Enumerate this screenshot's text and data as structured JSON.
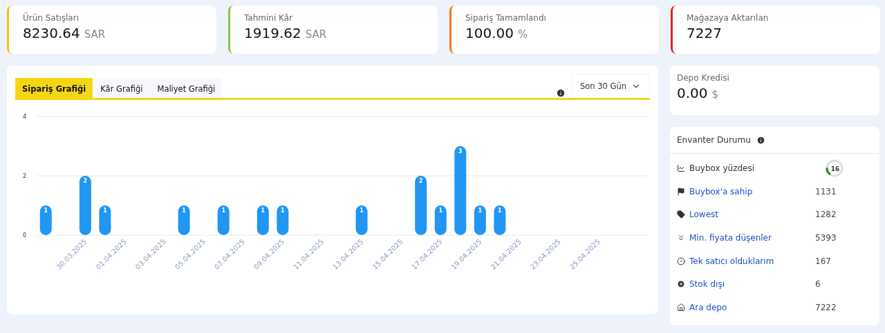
{
  "stat_cards": [
    {
      "label": "Ürün Satışları",
      "value": "8230.64",
      "unit": "SAR",
      "color": "#f5c211"
    },
    {
      "label": "Tahmini Kâr",
      "value": "1919.62",
      "unit": "SAR",
      "color": "#8bc34a"
    },
    {
      "label": "Sipariş Tamamlandı",
      "value": "100.00",
      "unit": "%",
      "color": "#f97316"
    },
    {
      "label": "Mağazaya Aktarılan",
      "value": "7227",
      "color": "#dc2626"
    }
  ],
  "chart_panel": {
    "tabs": [
      {
        "label": "Sipariş Grafiği",
        "selected": true
      },
      {
        "label": "Kâr Grafiği",
        "selected": false
      },
      {
        "label": "Maliyet Grafiği",
        "selected": false
      }
    ],
    "period": "Son 30 Gün",
    "chart_data": {
      "type": "bar",
      "categories": [
        null,
        null,
        "30.03.2025",
        null,
        "01.04.2025",
        null,
        "03.04.2025",
        null,
        "05.04.2025",
        null,
        "07.04.2025",
        null,
        "09.04.2025",
        null,
        "11.04.2025",
        null,
        "13.04.2025",
        null,
        "15.04.2025",
        null,
        "17.04.2025",
        null,
        "19.04.2025",
        null,
        "21.04.2025",
        null,
        "23.04.2025",
        null,
        "25.04.2025",
        null,
        null
      ],
      "series": [
        {
          "color": "#2196f3",
          "values": [
            1,
            null,
            2,
            1,
            null,
            null,
            null,
            1,
            null,
            1,
            null,
            1,
            1,
            null,
            null,
            null,
            1,
            null,
            null,
            2,
            1,
            3,
            1,
            1,
            null,
            null,
            null,
            null,
            null,
            null,
            null
          ]
        }
      ],
      "ylim": [
        0,
        4
      ],
      "yticks": [
        0,
        2,
        4
      ],
      "data_labels": true
    }
  },
  "depot_credit": {
    "label": "Depo Kredisi",
    "value": "0.00",
    "unit": "$"
  },
  "inventory": {
    "title": "Envanter Durumu",
    "rows": [
      {
        "kind": "gauge",
        "label": "Buybox yüzdesi",
        "value": "16",
        "level": 0.16
      },
      {
        "kind": "link",
        "label": "Buybox'a sahip",
        "value": "1131"
      },
      {
        "kind": "link",
        "label": "Lowest",
        "value": "1282"
      },
      {
        "kind": "link",
        "label": "Min. fiyata düşenler",
        "value": "5393"
      },
      {
        "kind": "link",
        "label": "Tek satıcı olduklarım",
        "value": "167"
      },
      {
        "kind": "link",
        "label": "Stok dışı",
        "value": "6"
      },
      {
        "kind": "link",
        "label": "Ara depo",
        "value": "7222"
      }
    ]
  }
}
